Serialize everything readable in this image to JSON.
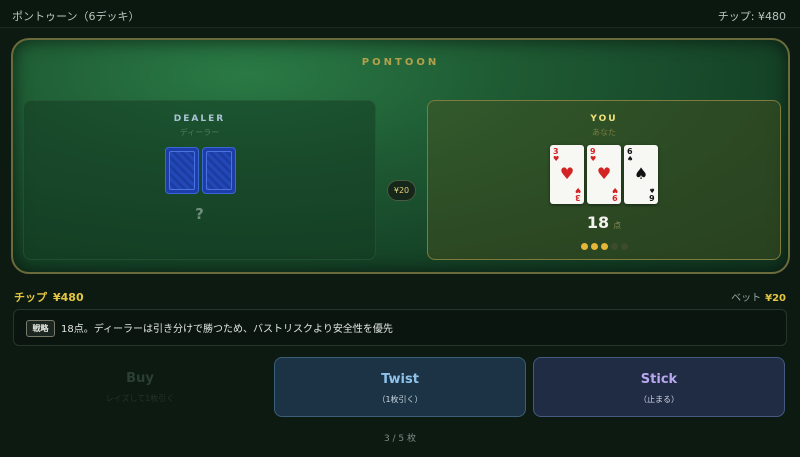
{
  "header": {
    "title": "ポントゥーン（6デッキ）",
    "chips": "チップ: ¥480"
  },
  "table": {
    "title": "PONTOON"
  },
  "dealer": {
    "label": "DEALER",
    "sub": "ディーラー",
    "total": "?",
    "hidden_cards": 2
  },
  "player": {
    "label": "YOU",
    "sub": "あなた",
    "cards": [
      {
        "rank": "3",
        "suit": "♥",
        "color": "red"
      },
      {
        "rank": "9",
        "suit": "♥",
        "color": "red"
      },
      {
        "rank": "6",
        "suit": "♠",
        "color": "black"
      }
    ],
    "total": "18",
    "total_unit": "点",
    "progress": {
      "filled": 3,
      "max": 5
    }
  },
  "bet_chip": "¥20",
  "status": {
    "chips_label": "チップ",
    "chips_value": "¥480",
    "bet_label": "ベット",
    "bet_value": "¥20"
  },
  "hint": {
    "tag": "戦略",
    "text": "18点。ディーラーは引き分けで勝つため、バストリスクより安全性を優先"
  },
  "actions": {
    "buy": {
      "label": "Buy",
      "sub": "レイズして1枚引く",
      "enabled": false
    },
    "twist": {
      "label": "Twist",
      "sub": "（1枚引く）",
      "enabled": true
    },
    "stick": {
      "label": "Stick",
      "sub": "（止まる）",
      "enabled": true
    }
  },
  "footer": {
    "card_count": "3 / 5 枚"
  },
  "colors": {
    "accent": "#e3c640",
    "felt": "#1e5a33",
    "twist": "#8fc2ea",
    "stick": "#b9a8f0"
  },
  "icons": {
    "card_back": "card-back-icon",
    "chip": "bet-chip-icon"
  }
}
